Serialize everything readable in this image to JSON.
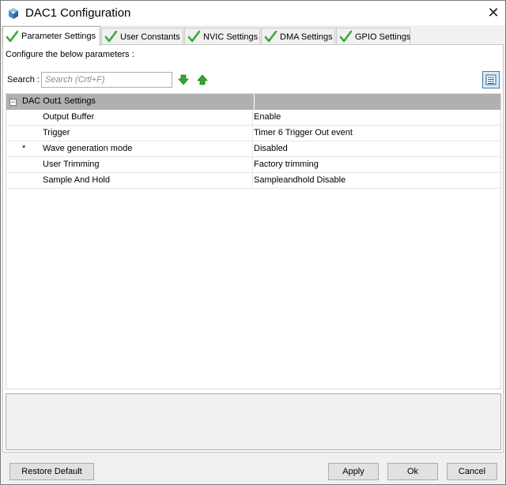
{
  "window": {
    "title": "DAC1 Configuration",
    "close_glyph": "✕",
    "app_icon": "cube-icon"
  },
  "tabs": [
    {
      "label": "Parameter Settings",
      "icon": "green-check-icon",
      "active": true
    },
    {
      "label": "User Constants",
      "icon": "green-check-icon",
      "active": false
    },
    {
      "label": "NVIC Settings",
      "icon": "green-check-icon",
      "active": false
    },
    {
      "label": "DMA Settings",
      "icon": "green-check-icon",
      "active": false
    },
    {
      "label": "GPIO Settings",
      "icon": "green-check-icon",
      "active": false
    }
  ],
  "panel": {
    "instruction": "Configure the below parameters :",
    "search_label": "Search :",
    "search_placeholder": "Search (Crtl+F)",
    "search_value": ""
  },
  "grid": {
    "group": {
      "collapse_glyph": "−",
      "title": "DAC Out1 Settings"
    },
    "rows": [
      {
        "marker": "",
        "name": "Output Buffer",
        "value": "Enable"
      },
      {
        "marker": "",
        "name": "Trigger",
        "value": "Timer 6 Trigger Out event"
      },
      {
        "marker": "*",
        "name": "Wave generation mode",
        "value": "Disabled"
      },
      {
        "marker": "",
        "name": "User Trimming",
        "value": "Factory trimming"
      },
      {
        "marker": "",
        "name": "Sample And Hold",
        "value": "Sampleandhold Disable"
      }
    ]
  },
  "buttons": {
    "restore_default": "Restore Default",
    "apply": "Apply",
    "ok": "Ok",
    "cancel": "Cancel"
  },
  "colors": {
    "check_green": "#3aaa35",
    "arrow_green": "#2fa82f",
    "group_header": "#b0b0b0"
  }
}
